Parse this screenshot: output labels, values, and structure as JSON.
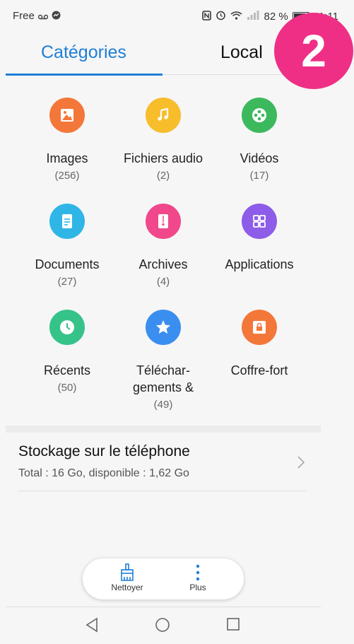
{
  "status": {
    "carrier": "Free",
    "battery": "82 %",
    "time": "11:11"
  },
  "tabs": [
    {
      "label": "Catégories",
      "active": true
    },
    {
      "label": "Local",
      "active": false
    }
  ],
  "badge": {
    "value": "2",
    "color": "#ef2f86"
  },
  "categories": [
    {
      "label": "Images",
      "count": "(256)",
      "color": "#f4773a",
      "icon": "image-icon"
    },
    {
      "label": "Fichiers audio",
      "count": "(2)",
      "color": "#f7bd2b",
      "icon": "music-note-icon"
    },
    {
      "label": "Vidéos",
      "count": "(17)",
      "color": "#3db95d",
      "icon": "film-reel-icon"
    },
    {
      "label": "Documents",
      "count": "(27)",
      "color": "#2fb6e6",
      "icon": "document-icon"
    },
    {
      "label": "Archives",
      "count": "(4)",
      "color": "#f0488b",
      "icon": "archive-zip-icon"
    },
    {
      "label": "Applications",
      "count": "",
      "color": "#8d5ce8",
      "icon": "apps-grid-icon"
    },
    {
      "label": "Récents",
      "count": "(50)",
      "color": "#35c38a",
      "icon": "clock-icon"
    },
    {
      "label": "Téléchar-\ngements &",
      "count": "(49)",
      "color": "#3a8ef0",
      "icon": "star-icon"
    },
    {
      "label": "Coffre-fort",
      "count": "",
      "color": "#f4773a",
      "icon": "safe-lock-icon"
    }
  ],
  "storage": {
    "title": "Stockage sur le téléphone",
    "subtitle": "Total : 16 Go, disponible : 1,62 Go"
  },
  "toolbar": {
    "clean_label": "Nettoyer",
    "more_label": "Plus",
    "accent": "#1e7fd6"
  },
  "navbar": [
    "back-icon",
    "home-icon",
    "recents-icon"
  ]
}
